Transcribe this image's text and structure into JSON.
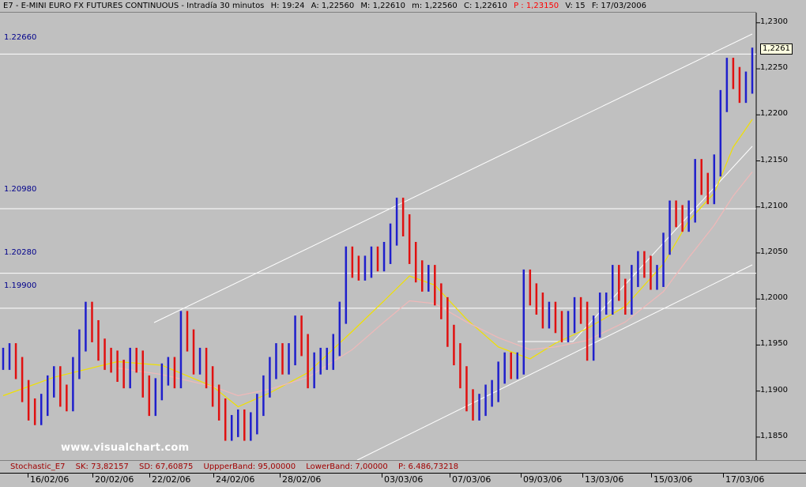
{
  "header": {
    "symbol": "E7 - E-MINI EURO FX FUTURES CONTINUOUS - Intradía 30 minutos",
    "h": "H: 19:24",
    "a": "A: 1,22560",
    "m": "M: 1,22610",
    "mm": "m: 1,22560",
    "c": "C: 1,22610",
    "p": "P : 1,23150",
    "v": "V: 15",
    "f": "F: 17/03/2006"
  },
  "levels": [
    "1.22660",
    "1.20980",
    "1.20280",
    "1.19900"
  ],
  "current_price": "1,2261",
  "watermark": "www.visualchart.com",
  "footer": {
    "name": "Stochastic_E7",
    "sk": "SK: 73,82157",
    "sd": "SD: 67,60875",
    "upper": "UppperBand: 95,00000",
    "lower": "LowerBand: 7,00000",
    "p": "P: 6.486,73218"
  },
  "colors": {
    "up": "#1f1fcc",
    "down": "#e01010",
    "ma_fast": "#f0e000",
    "ma_slow": "#f0b8b8",
    "bg": "#c0c0c0"
  },
  "chart_data": {
    "type": "line",
    "title": "E7 - E-MINI EURO FX FUTURES CONTINUOUS - Intradía 30 minutos",
    "x_tick_labels": [
      "16/02/06",
      "20/02/06",
      "22/02/06",
      "24/02/06",
      "28/02/06",
      "03/03/06",
      "07/03/06",
      "09/03/06",
      "13/03/06",
      "15/03/06",
      "17/03/06"
    ],
    "y_tick_labels": [
      "1,2300",
      "1,2250",
      "1,2200",
      "1,2150",
      "1,2100",
      "1,2050",
      "1,2000",
      "1,1950",
      "1,1900",
      "1,1850"
    ],
    "y_ticks": [
      1.23,
      1.225,
      1.22,
      1.215,
      1.21,
      1.205,
      1.2,
      1.195,
      1.19,
      1.185
    ],
    "ylim": [
      1.1825,
      1.2311
    ],
    "horizontal_levels": [
      1.2266,
      1.2098,
      1.2028,
      1.199
    ],
    "series": [
      {
        "x": [
          0,
          1,
          2,
          3,
          4,
          5,
          6,
          7,
          8,
          9,
          10,
          11,
          12,
          13,
          14,
          15,
          16,
          17,
          18,
          19,
          20,
          21,
          22,
          23,
          24,
          25,
          26,
          27,
          28,
          29,
          30,
          31,
          32,
          33,
          34,
          35,
          36,
          37,
          38,
          39,
          40,
          41,
          42,
          43,
          44,
          45,
          46,
          47,
          48,
          49,
          50,
          51,
          52,
          53,
          54,
          55,
          56,
          57,
          58,
          59,
          60,
          61,
          62,
          63,
          64,
          65,
          66,
          67,
          68,
          69,
          70,
          71,
          72,
          73,
          74,
          75,
          76,
          77,
          78,
          79,
          80,
          81,
          82,
          83,
          84,
          85,
          86,
          87,
          88,
          89,
          90,
          91,
          92,
          93,
          94,
          95,
          96,
          97,
          98,
          99,
          100,
          101,
          102,
          103,
          104,
          105,
          106,
          107,
          108,
          109,
          110,
          111,
          112,
          113,
          114,
          115,
          116,
          117,
          118
        ],
        "values": [
          1.1935,
          1.194,
          1.1925,
          1.19,
          1.188,
          1.1875,
          1.1885,
          1.1905,
          1.1915,
          1.1895,
          1.189,
          1.1925,
          1.1955,
          1.1985,
          1.1965,
          1.1945,
          1.1935,
          1.1932,
          1.1922,
          1.1915,
          1.1935,
          1.1932,
          1.1905,
          1.1885,
          1.1902,
          1.1918,
          1.1925,
          1.1915,
          1.1975,
          1.1955,
          1.193,
          1.1935,
          1.1915,
          1.1895,
          1.188,
          1.1858,
          1.1862,
          1.1868,
          1.1858,
          1.1865,
          1.1885,
          1.1905,
          1.1925,
          1.194,
          1.193,
          1.194,
          1.197,
          1.195,
          1.1915,
          1.193,
          1.1935,
          1.1935,
          1.195,
          1.1985,
          1.2045,
          1.2035,
          1.2032,
          1.2035,
          1.2045,
          1.2042,
          1.205,
          1.207,
          1.2098,
          1.208,
          1.205,
          1.203,
          1.202,
          1.2025,
          1.2005,
          1.199,
          1.196,
          1.194,
          1.1915,
          1.189,
          1.188,
          1.1885,
          1.1895,
          1.19,
          1.192,
          1.193,
          1.1925,
          1.193,
          1.202,
          1.2005,
          1.1995,
          1.198,
          1.1985,
          1.1975,
          1.1965,
          1.1975,
          1.199,
          1.1985,
          1.1945,
          1.197,
          1.1995,
          1.1995,
          1.2025,
          1.201,
          1.1995,
          1.2025,
          1.204,
          1.2035,
          1.2022,
          1.2025,
          1.206,
          1.2095,
          1.209,
          1.2085,
          1.2095,
          1.214,
          1.2125,
          1.2115,
          1.2145,
          1.2215,
          1.225,
          1.224,
          1.2225,
          1.2235,
          1.2261
        ],
        "name": ""
      },
      {
        "x": [
          0,
          8,
          18,
          25,
          33,
          37,
          42,
          48,
          55,
          60,
          64,
          68,
          73,
          78,
          83,
          87,
          92,
          98,
          104,
          108,
          112,
          115,
          118
        ],
        "values": [
          1.1895,
          1.1915,
          1.1932,
          1.1928,
          1.1905,
          1.1883,
          1.1898,
          1.192,
          1.1965,
          1.1998,
          1.2025,
          1.2015,
          1.1978,
          1.1948,
          1.1935,
          1.1952,
          1.1968,
          1.1992,
          1.2038,
          1.2085,
          1.2115,
          1.2165,
          1.2195
        ],
        "name": ""
      },
      {
        "x": [
          18,
          25,
          33,
          37,
          42,
          48,
          55,
          60,
          64,
          68,
          73,
          78,
          83,
          87,
          92,
          98,
          104,
          108,
          112,
          115,
          118
        ],
        "values": [
          1.1925,
          1.1918,
          1.1905,
          1.1895,
          1.1902,
          1.1915,
          1.1945,
          1.1975,
          1.1998,
          1.1995,
          1.1975,
          1.1958,
          1.1945,
          1.1948,
          1.1955,
          1.1975,
          1.2008,
          1.2045,
          1.208,
          1.2112,
          1.2138
        ],
        "name": ""
      }
    ]
  }
}
